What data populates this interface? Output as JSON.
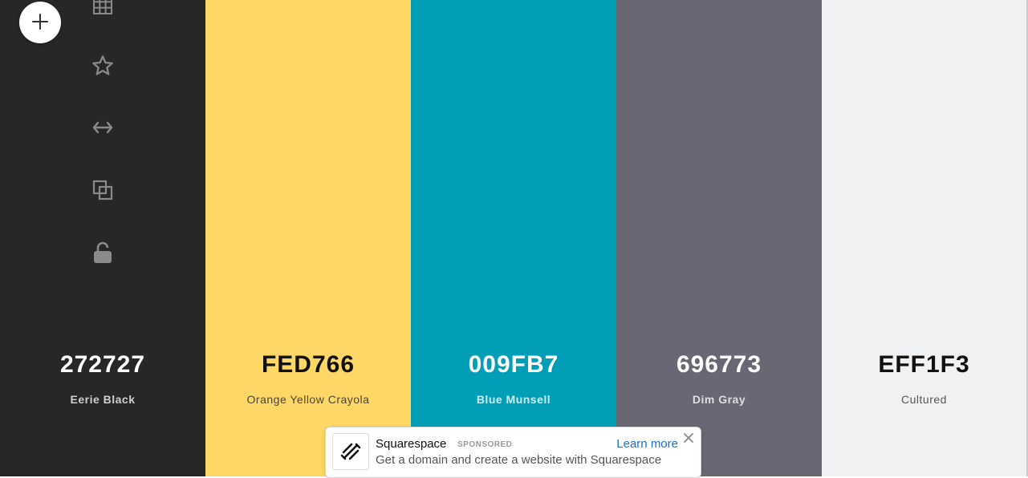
{
  "palette": [
    {
      "hex": "272727",
      "name": "Eerie Black",
      "bg": "#272727",
      "hex_color": "#ffffff",
      "name_color": "#cfcfcf"
    },
    {
      "hex": "FED766",
      "name": "Orange Yellow Crayola",
      "bg": "#FED766",
      "hex_color": "#111111",
      "name_color": "#4a4636"
    },
    {
      "hex": "009FB7",
      "name": "Blue Munsell",
      "bg": "#009FB7",
      "hex_color": "#ffffff",
      "name_color": "#c9ecf1"
    },
    {
      "hex": "696773",
      "name": "Dim Gray",
      "bg": "#696773",
      "hex_color": "#ffffff",
      "name_color": "#dddde2"
    },
    {
      "hex": "EFF1F3",
      "name": "Cultured",
      "bg": "#EFF1F3",
      "hex_color": "#111111",
      "name_color": "#555559"
    }
  ],
  "toolbar": {
    "icons": [
      "grid-icon",
      "star-icon",
      "drag-arrows-icon",
      "copy-icon",
      "unlock-icon"
    ],
    "icon_color": "#8a8a8a"
  },
  "add_button": {
    "icon": "plus-icon"
  },
  "ad": {
    "brand": "Squarespace",
    "sponsored": "SPONSORED",
    "cta": "Learn more",
    "description": "Get a domain and create a website with Squarespace",
    "logo_icon": "squarespace-logo-icon",
    "close_icon": "close-icon"
  }
}
